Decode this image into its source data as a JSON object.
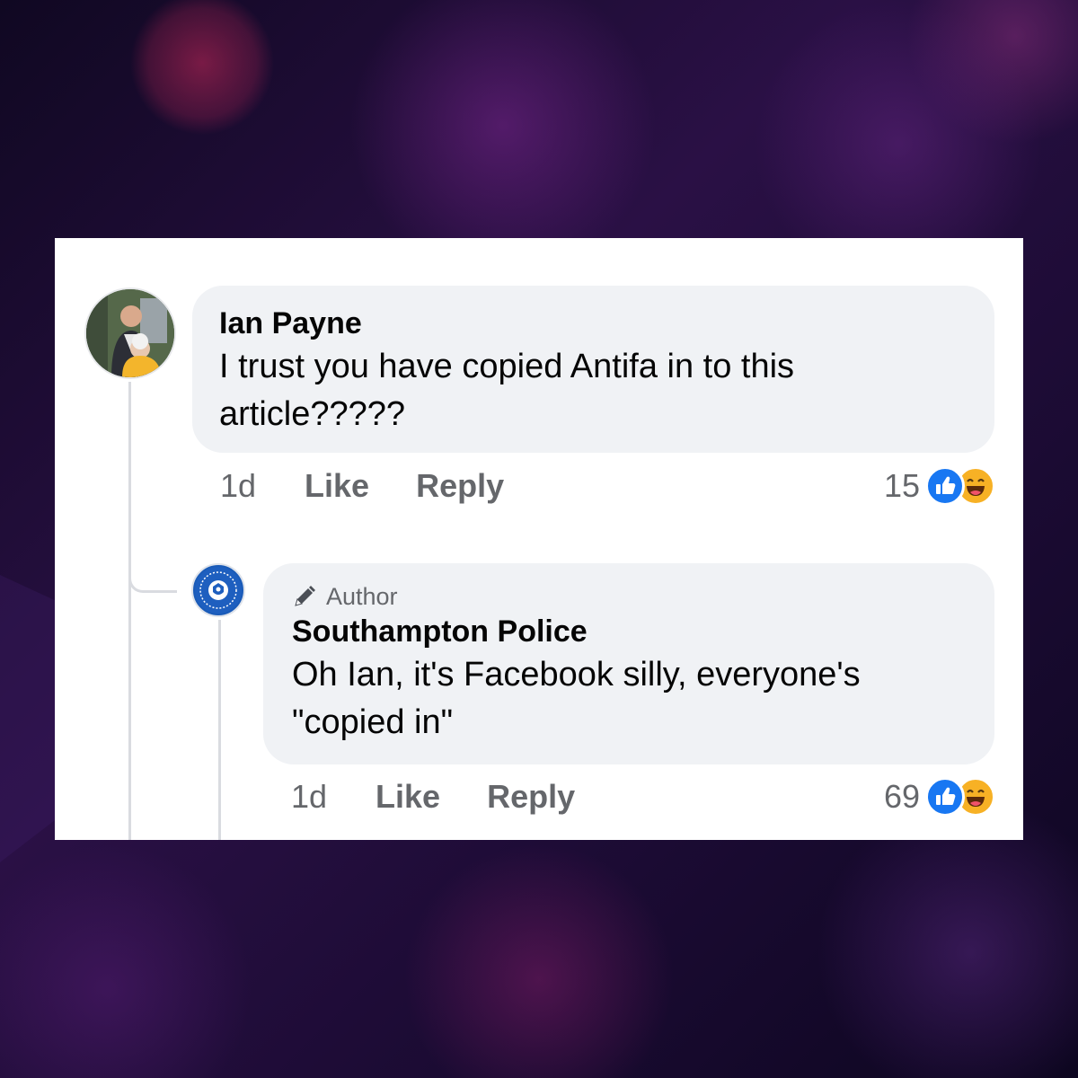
{
  "comments": [
    {
      "author": "Ian Payne",
      "text": "I trust you have copied Antifa in to this article?????",
      "time": "1d",
      "like_label": "Like",
      "reply_label": "Reply",
      "reaction_count": "15",
      "reactions": [
        "like-icon",
        "haha-icon"
      ]
    },
    {
      "author_tag": "Author",
      "author": "Southampton Police",
      "text": "Oh Ian, it's Facebook silly, everyone's \"copied in\"",
      "time": "1d",
      "like_label": "Like",
      "reply_label": "Reply",
      "reaction_count": "69",
      "reactions": [
        "like-icon",
        "haha-icon"
      ]
    }
  ],
  "colors": {
    "bubble": "#f0f2f5",
    "meta_text": "#65676b",
    "like_blue": "#1877f2",
    "haha_yellow": "#f7b125"
  }
}
